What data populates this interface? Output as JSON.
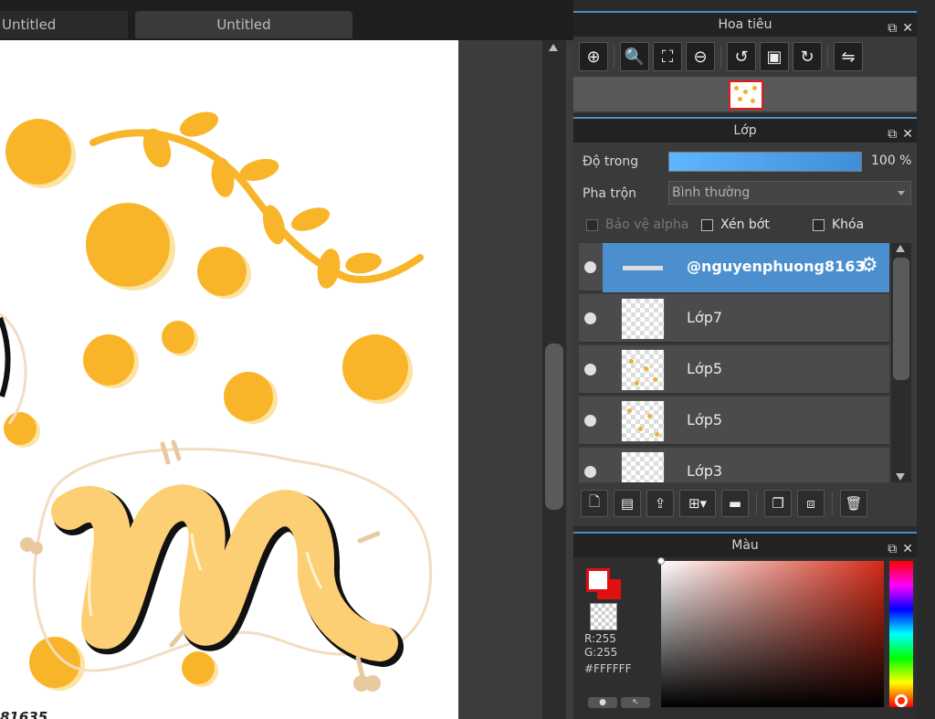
{
  "tabs": [
    {
      "label": "Untitled"
    },
    {
      "label": "Untitled"
    }
  ],
  "canvas": {
    "watermark": "81635",
    "artwork_colors": {
      "dot": "#f9b52a",
      "dot_shadow": "#fde3a1",
      "ribbon": "#fccf75",
      "outline": "#111111",
      "halo": "#f4dcc1"
    }
  },
  "navigator": {
    "title": "Hoa tiêu",
    "tools": [
      "zoom-fit-icon",
      "zoom-in-icon",
      "fit-screen-icon",
      "zoom-out-icon",
      "rotate-left-icon",
      "actual-size-icon",
      "rotate-right-icon",
      "flip-icon"
    ]
  },
  "layers_panel": {
    "title": "Lớp",
    "opacity_label": "Độ trong",
    "opacity_value": "100 %",
    "opacity_fraction": 1.0,
    "blend_label": "Pha trộn",
    "blend_value": "Bình thường",
    "protect_alpha_label": "Bảo vệ alpha",
    "clipping_label": "Xén bớt",
    "lock_label": "Khóa",
    "layers": [
      {
        "name": "@nguyenphuong8163",
        "selected": true
      },
      {
        "name": "Lớp7",
        "selected": false
      },
      {
        "name": "Lớp5",
        "selected": false
      },
      {
        "name": "Lớp5",
        "selected": false
      },
      {
        "name": "Lớp3",
        "selected": false
      }
    ],
    "tools": [
      "new-layer-icon",
      "new-raster-layer-icon",
      "import-layer-icon",
      "add-layer-menu-icon",
      "folder-icon",
      "duplicate-icon",
      "merge-icon",
      "delete-icon"
    ]
  },
  "color_panel": {
    "title": "Màu",
    "r_label": "R:255",
    "g_label": "G:255",
    "hex": "#FFFFFF",
    "foreground": "#ffffff",
    "background": "#e01010"
  },
  "accent": "#4a8ccd"
}
